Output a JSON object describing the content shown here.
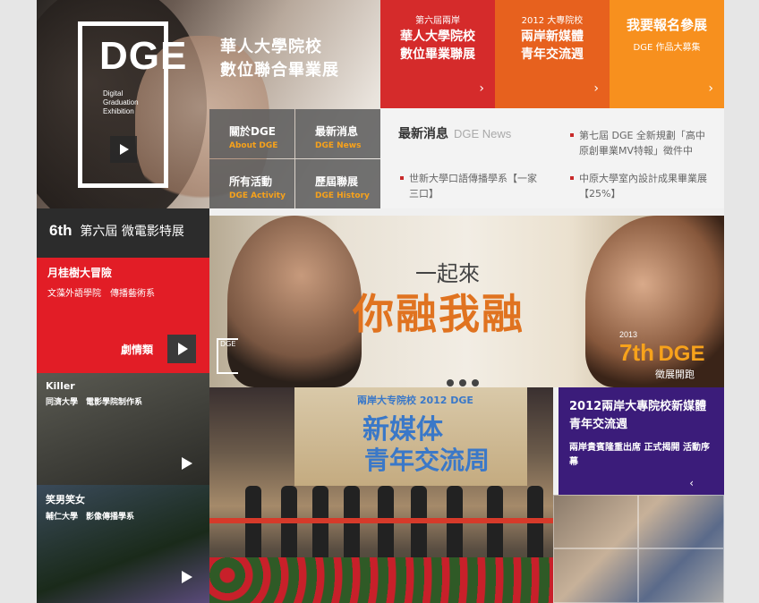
{
  "hero": {
    "logo": "DGE",
    "logo_sub1": "Digital",
    "logo_sub2": "Graduation",
    "logo_sub3": "Exhibition",
    "title_line1": "華人大學院校",
    "title_line2": "數位聯合畢業展"
  },
  "nav": [
    {
      "zh": "關於DGE",
      "en": "About DGE"
    },
    {
      "zh": "最新消息",
      "en": "DGE News"
    },
    {
      "zh": "所有活動",
      "en": "DGE Activity"
    },
    {
      "zh": "歷屆聯展",
      "en": "DGE History"
    }
  ],
  "tiles": [
    {
      "line1": "第六屆兩岸",
      "line2": "華人大學院校",
      "line3": "數位畢業聯展",
      "color": "#d52b2b"
    },
    {
      "line1": "2012 大專院校",
      "line2": "兩岸新媒體",
      "line3": "青年交流週",
      "color": "#e7611e"
    },
    {
      "line1": "我要報名參展",
      "line2": "DGE 作品大募集",
      "color": "#f7901e"
    }
  ],
  "news": {
    "heading": "最新消息",
    "heading_en": "DGE News",
    "items": [
      {
        "text": "第七屆 DGE 全新規劃「高中原創畢業MV特報」徵件中"
      },
      {
        "text": "世新大學口語傳播學系【一家三口】"
      },
      {
        "text": "中原大學室內設計成果畢業展【25%】"
      }
    ]
  },
  "film_section": {
    "num": "6th",
    "title": "第六屆 微電影特展"
  },
  "films": [
    {
      "title": "月桂樹大冒險",
      "school": "文藻外語學院　傳播藝術系",
      "genre": "劇情類"
    },
    {
      "title": "Killer",
      "school": "同濟大學　電影學院制作系"
    },
    {
      "title": "笑男笑女",
      "school": "輔仁大學　影像傳播學系"
    }
  ],
  "banner": {
    "line1": "一起來",
    "line2": "你融我融",
    "year": "2013",
    "edition": "7th",
    "dge": "DGE",
    "open": "徵展開跑",
    "mini": "DGE"
  },
  "event": {
    "screen_top": "兩岸大专院校 2012 DGE",
    "screen_l1": "新媒体",
    "screen_l2": "青年交流周"
  },
  "info": {
    "title": "2012兩岸大專院校新媒體青年交流週",
    "desc": "兩岸貴賓隆重出席 正式揭開 活動序幕",
    "arrow": "‹"
  }
}
